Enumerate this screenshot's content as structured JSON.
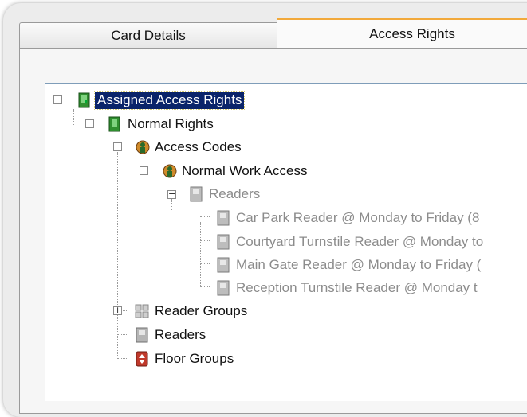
{
  "tabs": [
    {
      "label": "Card Details",
      "active": false
    },
    {
      "label": "Access Rights",
      "active": true
    }
  ],
  "tree": {
    "root": {
      "label": "Assigned Access Rights",
      "icon": "green-door-icon",
      "selected": true
    },
    "normal_rights": {
      "label": "Normal Rights",
      "icon": "green-door-icon"
    },
    "access_codes": {
      "label": "Access Codes",
      "icon": "globe-person-icon"
    },
    "normal_work_access": {
      "label": "Normal Work Access",
      "icon": "globe-person-icon"
    },
    "readers_group": {
      "label": "Readers",
      "icon": "card-reader-icon",
      "disabled": true
    },
    "reader_items": [
      {
        "label": "Car Park Reader @ Monday to Friday (8",
        "icon": "card-reader-icon"
      },
      {
        "label": "Courtyard Turnstile Reader @ Monday to",
        "icon": "card-reader-icon"
      },
      {
        "label": "Main Gate Reader @ Monday to Friday (",
        "icon": "card-reader-icon"
      },
      {
        "label": "Reception Turnstile Reader @ Monday t",
        "icon": "card-reader-icon"
      }
    ],
    "reader_groups": {
      "label": "Reader Groups",
      "icon": "grid-group-icon"
    },
    "readers": {
      "label": "Readers",
      "icon": "card-reader-icon"
    },
    "floor_groups": {
      "label": "Floor Groups",
      "icon": "elevator-icon"
    }
  },
  "colors": {
    "selection": "#0a246a",
    "active_tab_accent": "#f2a93b",
    "disabled_text": "#8c8c8c"
  }
}
